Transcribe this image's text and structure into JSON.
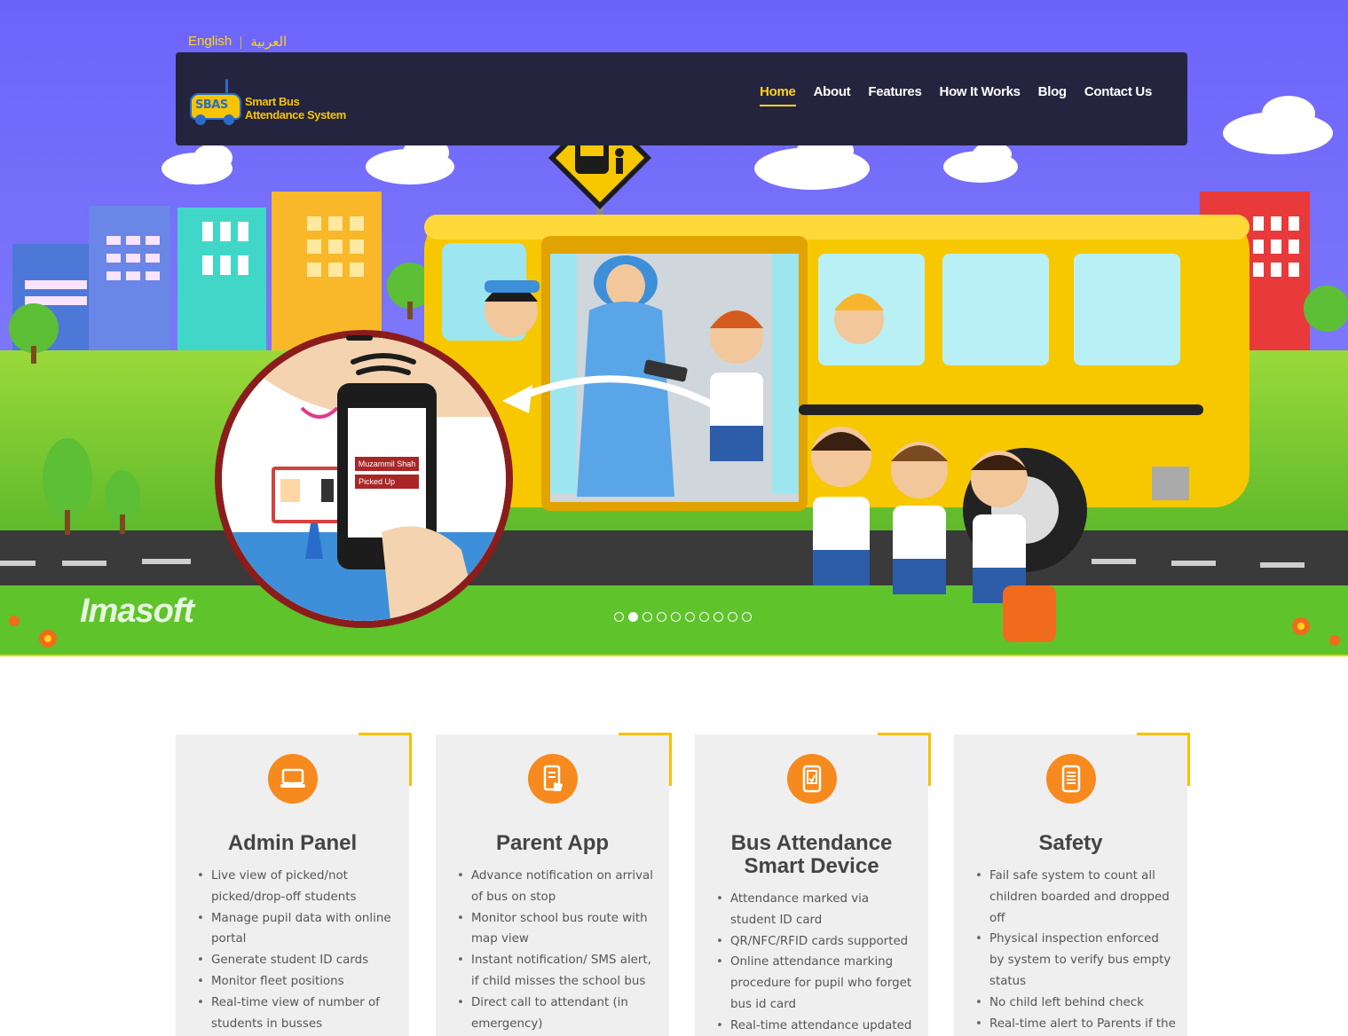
{
  "language_bar": {
    "english": "English",
    "arabic": "العربية"
  },
  "logo": {
    "badge": "SBAS",
    "name_line1": "Smart Bus",
    "name_line2": "Attendance System"
  },
  "nav": {
    "items": [
      {
        "label": "Home",
        "active": true
      },
      {
        "label": "About",
        "active": false
      },
      {
        "label": "Features",
        "active": false
      },
      {
        "label": "How It Works",
        "active": false
      },
      {
        "label": "Blog",
        "active": false
      },
      {
        "label": "Contact Us",
        "active": false
      }
    ]
  },
  "hero": {
    "brand_watermark": "Imasoft",
    "phone_card_name": "Muzammil Shah",
    "phone_card_status": "Picked Up",
    "slide_count": 10,
    "active_slide": 2
  },
  "features": [
    {
      "icon": "laptop-icon",
      "title": "Admin Panel",
      "items": [
        "Live view of picked/not picked/drop-off students",
        "Manage pupil data with online portal",
        "Generate student ID cards",
        "Monitor fleet positions",
        "Real-time view of number of students in busses"
      ]
    },
    {
      "icon": "phone-app-icon",
      "title": "Parent App",
      "items": [
        "Advance notification on arrival of bus on stop",
        "Monitor school bus route with map view",
        "Instant notification/ SMS alert, if child misses the school bus",
        "Direct call to attendant (in emergency)"
      ]
    },
    {
      "icon": "smart-device-icon",
      "title": "Bus Attendance Smart Device",
      "items": [
        "Attendance marked via student ID card",
        "QR/NFC/RFID cards supported",
        "Online attendance marking procedure for pupil who forget bus id card",
        "Real-time attendance updated"
      ]
    },
    {
      "icon": "device-safety-icon",
      "title": "Safety",
      "items": [
        "Fail safe system to count all children boarded and dropped off",
        "Physical inspection enforced by system to verify bus empty status",
        "No child left behind check",
        "Real-time alert to Parents if the"
      ]
    }
  ],
  "colors": {
    "sky": "#6f6cfb",
    "navbar": "#24243f",
    "accent_yellow": "#ffd51a",
    "icon_orange": "#f68a1e",
    "card_bg": "#efefef"
  }
}
